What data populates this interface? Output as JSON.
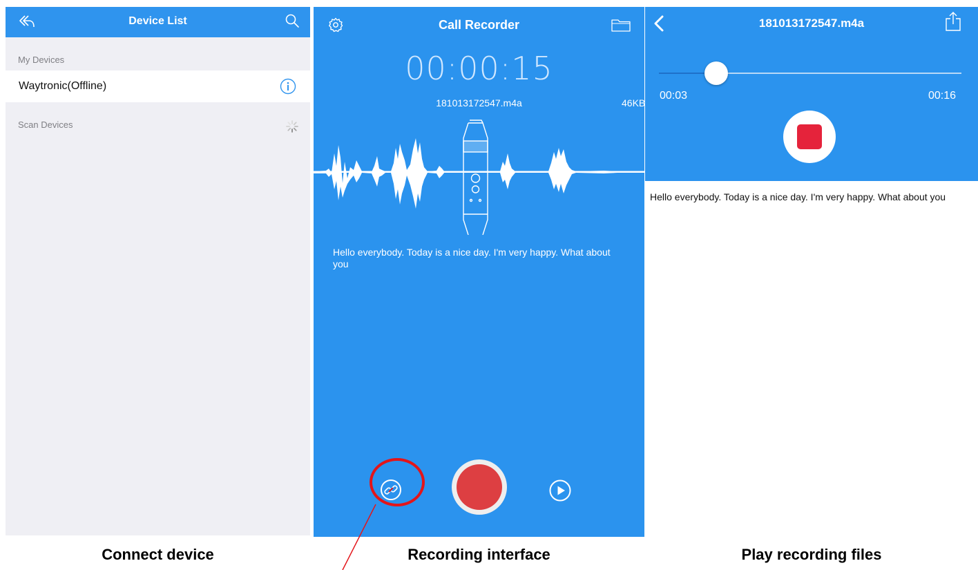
{
  "device_list_screen": {
    "title": "Device List",
    "my_devices_label": "My Devices",
    "device_name": "Waytronic(Offline)",
    "scan_devices_label": "Scan Devices",
    "caption": "Connect device"
  },
  "recorder_screen": {
    "title": "Call Recorder",
    "timer": "00:00:15",
    "file_name": "181013172547.m4a",
    "file_size": "46KB",
    "transcript": "Hello everybody. Today is a nice day. I'm very happy. What about you",
    "caption": "Recording interface"
  },
  "player_screen": {
    "title": "181013172547.m4a",
    "current_time": "00:03",
    "total_time": "00:16",
    "progress": 0.19,
    "transcript": "Hello everybody. Today is a nice day. I'm very happy. What about you",
    "caption": "Play recording files"
  },
  "colors": {
    "primary_blue": "#2b93ee",
    "nav_blue": "#2f94ee",
    "record_red": "#dd3f42",
    "stop_red": "#e5233b",
    "annotation_red": "#e3151a",
    "list_background": "#efeff4"
  },
  "icons": {
    "device_list": [
      "back-arrow-icon",
      "search-icon",
      "info-icon",
      "loading-spinner-icon"
    ],
    "recorder": [
      "gear-icon",
      "folder-icon",
      "link-icon",
      "record-icon",
      "play-icon"
    ],
    "player": [
      "chevron-left-icon",
      "share-icon",
      "stop-icon"
    ]
  }
}
